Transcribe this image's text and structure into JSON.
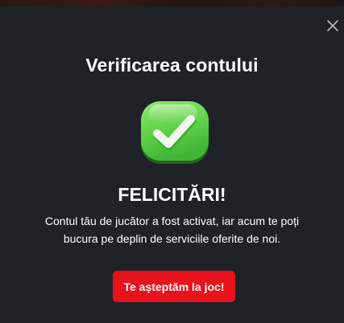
{
  "modal": {
    "title": "Verificarea contului",
    "heading": "FELICITĂRI!",
    "message": "Contul tău de jucător a fost activat, iar acum te poți bucura pe deplin de serviciile oferite de noi.",
    "cta_label": "Te așteptăm la joc!",
    "icon": "check-icon",
    "close_icon": "close-icon"
  },
  "colors": {
    "background": "#1f2227",
    "cta": "#e8121c",
    "check_green": "#6ed95a",
    "text": "#ffffff"
  }
}
